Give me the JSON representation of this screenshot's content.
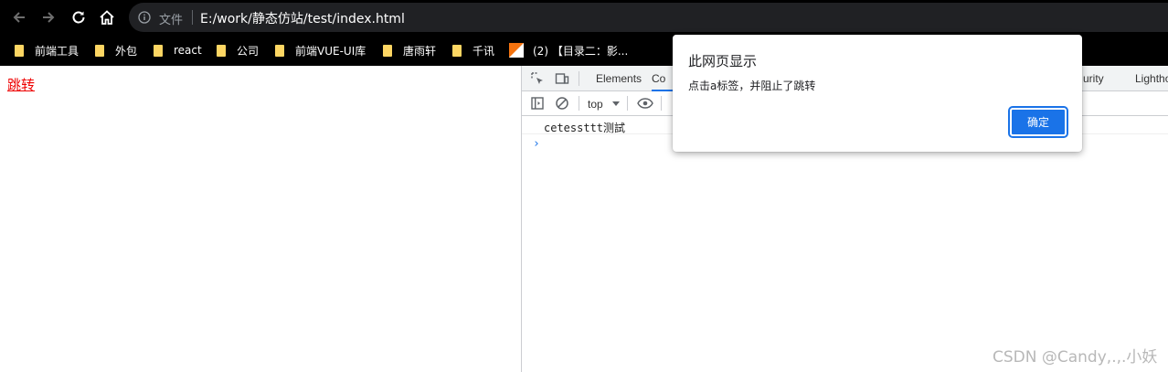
{
  "browser": {
    "address_scheme": "文件",
    "address_url": "E:/work/静态仿站/test/index.html"
  },
  "bookmarks": [
    {
      "label": "前端工具",
      "type": "folder"
    },
    {
      "label": "外包",
      "type": "folder"
    },
    {
      "label": "react",
      "type": "folder"
    },
    {
      "label": "公司",
      "type": "folder"
    },
    {
      "label": "前端VUE-UI库",
      "type": "folder"
    },
    {
      "label": "唐雨轩",
      "type": "folder"
    },
    {
      "label": "千讯",
      "type": "folder"
    },
    {
      "label": "(2) 【目录二：影...",
      "type": "page"
    }
  ],
  "page": {
    "link_text": "跳转"
  },
  "devtools": {
    "tabs": [
      "Elements",
      "Co",
      "urity",
      "Lightho"
    ],
    "context": "top",
    "log_message": "cetessttt测試",
    "prompt_symbol": "›"
  },
  "dialog": {
    "title": "此网页显示",
    "message": "点击a标签，并阻止了跳转",
    "ok_label": "确定"
  },
  "watermark": "CSDN @Candy,.,.小妖",
  "colors": {
    "accent": "#1a73e8",
    "link": "#ee0000",
    "folder": "#fdd663"
  }
}
